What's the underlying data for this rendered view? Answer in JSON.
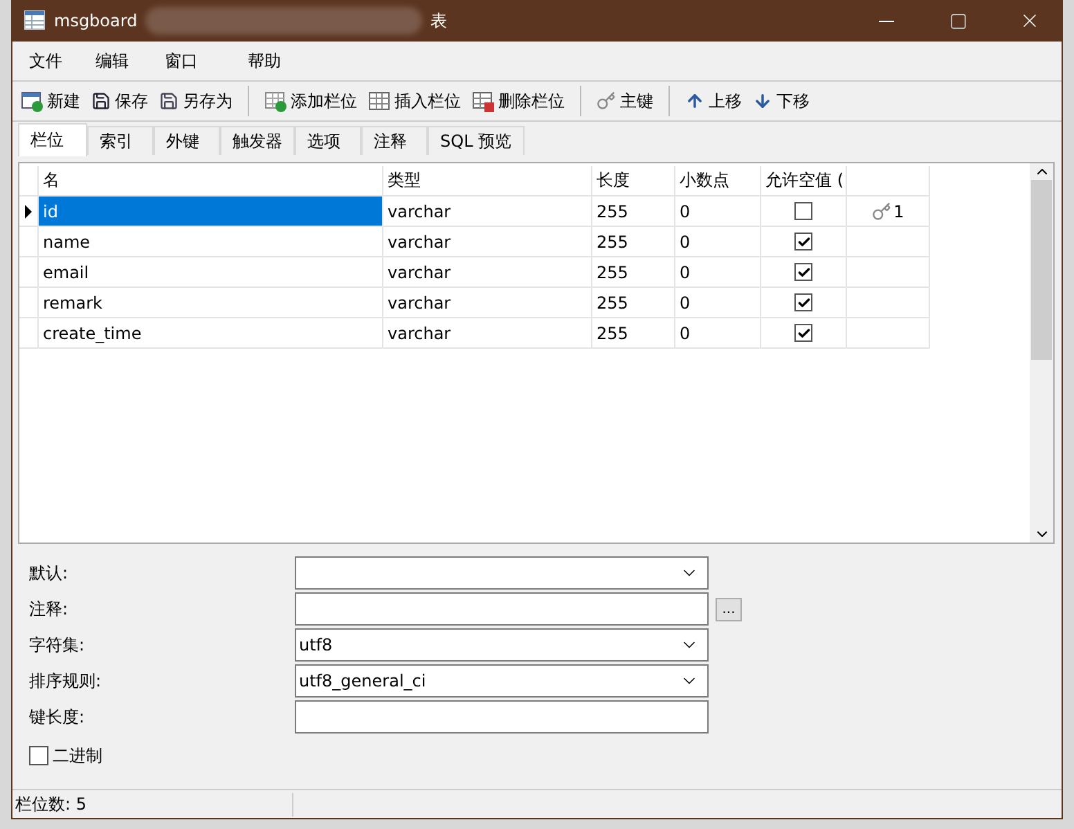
{
  "window": {
    "title": "msgboard",
    "title_suffix": "表"
  },
  "menu": [
    "文件",
    "编辑",
    "窗口",
    "帮助"
  ],
  "toolbar": [
    {
      "label": "新建",
      "kind": "new"
    },
    {
      "label": "保存",
      "kind": "save"
    },
    {
      "label": "另存为",
      "kind": "saveas"
    },
    {
      "kind": "sep"
    },
    {
      "label": "添加栏位",
      "kind": "add"
    },
    {
      "label": "插入栏位",
      "kind": "insert"
    },
    {
      "label": "删除栏位",
      "kind": "delete"
    },
    {
      "kind": "sep"
    },
    {
      "label": "主键",
      "kind": "key"
    },
    {
      "kind": "sep"
    },
    {
      "label": "上移",
      "kind": "up"
    },
    {
      "label": "下移",
      "kind": "down"
    }
  ],
  "tabs": [
    {
      "label": "栏位",
      "selected": true
    },
    {
      "label": "索引",
      "selected": false
    },
    {
      "label": "外键",
      "selected": false
    },
    {
      "label": "触发器",
      "selected": false
    },
    {
      "label": "选项",
      "selected": false
    },
    {
      "label": "注释",
      "selected": false
    },
    {
      "label": "SQL 预览",
      "selected": false
    }
  ],
  "table": {
    "columns": [
      "名",
      "类型",
      "长度",
      "小数点",
      "允许空值 ("
    ],
    "rows": [
      {
        "name": "id",
        "type": "varchar",
        "length": "255",
        "decimals": "0",
        "nullable": false,
        "key": "1",
        "selected": true
      },
      {
        "name": "name",
        "type": "varchar",
        "length": "255",
        "decimals": "0",
        "nullable": true,
        "selected": false
      },
      {
        "name": "email",
        "type": "varchar",
        "length": "255",
        "decimals": "0",
        "nullable": true,
        "selected": false
      },
      {
        "name": "remark",
        "type": "varchar",
        "length": "255",
        "decimals": "0",
        "nullable": true,
        "selected": false
      },
      {
        "name": "create_time",
        "type": "varchar",
        "length": "255",
        "decimals": "0",
        "nullable": true,
        "selected": false
      }
    ]
  },
  "properties": [
    {
      "label": "默认:",
      "kind": "dropdown"
    },
    {
      "label": "注释:",
      "kind": "text_more",
      "button": "..."
    },
    {
      "label": "字符集:",
      "kind": "dropdown",
      "value": "utf8"
    },
    {
      "label": "排序规则:",
      "kind": "dropdown",
      "value": "utf8_general_ci"
    },
    {
      "label": "键长度:",
      "kind": "text"
    }
  ],
  "binary": {
    "label": "二进制",
    "checked": false
  },
  "status_bar": "栏位数: 5"
}
